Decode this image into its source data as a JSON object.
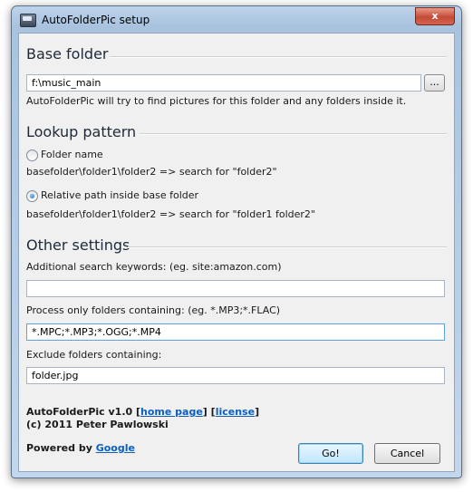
{
  "window": {
    "title": "AutoFolderPic setup",
    "close_glyph": "x"
  },
  "base_folder": {
    "heading": "Base folder",
    "path_value": "f:\\music_main",
    "browse_label": "...",
    "help_text": "AutoFolderPic will try to find pictures for this folder and any folders inside it."
  },
  "lookup_pattern": {
    "heading": "Lookup pattern",
    "option_folder_name": {
      "label": "Folder name",
      "checked": false,
      "example": "basefolder\\folder1\\folder2 => search for \"folder2\""
    },
    "option_relative_path": {
      "label": "Relative path inside base folder",
      "checked": true,
      "example": "basefolder\\folder1\\folder2 => search for \"folder1 folder2\""
    }
  },
  "other_settings": {
    "heading": "Other settings",
    "keywords_label": "Additional search keywords:  (eg. site:amazon.com)",
    "keywords_value": "",
    "process_label": "Process only folders containing:  (eg. *.MP3;*.FLAC)",
    "process_value": "*.MPC;*.MP3;*.OGG;*.MP4",
    "exclude_label": "Exclude folders containing:",
    "exclude_value": "folder.jpg"
  },
  "footer": {
    "version_prefix": "AutoFolderPic v1.0 [",
    "home_link": "home page",
    "mid_sep": "]  [",
    "license_link": "license",
    "suffix": "]",
    "copyright": "(c) 2011 Peter Pawlowski",
    "powered_by": "Powered by ",
    "google_link": "Google"
  },
  "buttons": {
    "go": "Go!",
    "cancel": "Cancel"
  },
  "colors": {
    "link": "#0b5fc2",
    "heading": "#1e2a3a",
    "close_button": "#c44a36"
  }
}
